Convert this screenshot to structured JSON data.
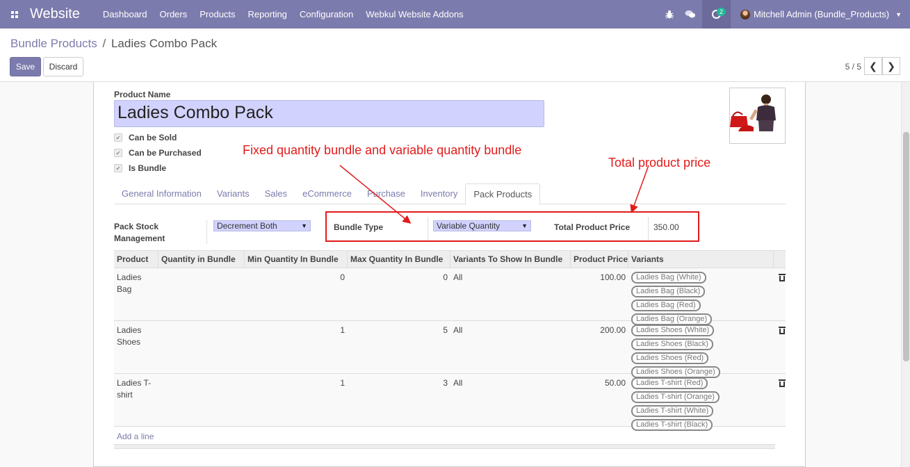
{
  "navbar": {
    "brand": "Website",
    "menu": [
      "Dashboard",
      "Orders",
      "Products",
      "Reporting",
      "Configuration",
      "Webkul Website Addons"
    ],
    "activity_count": "2",
    "user": "Mitchell Admin (Bundle_Products)",
    "icons": [
      "apps-icon",
      "bug-icon",
      "chat-icon",
      "activity-clock-icon",
      "caret-down-icon"
    ]
  },
  "breadcrumb": {
    "parent": "Bundle Products",
    "separator": "/",
    "current": "Ladies Combo Pack"
  },
  "buttons": {
    "save": "Save",
    "discard": "Discard"
  },
  "pager": {
    "value": "5 / 5",
    "prev": "❮",
    "next": "❯"
  },
  "form": {
    "product_name_label": "Product Name",
    "product_name": "Ladies Combo Pack",
    "checkboxes": [
      {
        "label": "Can be Sold",
        "checked": true
      },
      {
        "label": "Can be Purchased",
        "checked": true
      },
      {
        "label": "Is Bundle",
        "checked": true
      }
    ],
    "tabs": [
      "General Information",
      "Variants",
      "Sales",
      "eCommerce",
      "Purchase",
      "Inventory",
      "Pack Products"
    ],
    "active_tab": "Pack Products",
    "pack_stock_label": "Pack Stock Management",
    "pack_stock_value": "Decrement Both",
    "bundle_type_label": "Bundle Type",
    "bundle_type_value": "Variable Quantity",
    "total_price_label": "Total Product Price",
    "total_price_value": "350.00"
  },
  "annotations": {
    "bundle_note": "Fixed quantity bundle and variable quantity bundle",
    "price_note": "Total product price",
    "color": "#e21b1b"
  },
  "table": {
    "columns": [
      "Product",
      "Quantity in Bundle",
      "Min Quantity In Bundle",
      "Max Quantity In Bundle",
      "Variants To Show In Bundle",
      "Product Price",
      "Variants"
    ],
    "rows": [
      {
        "product": "Ladies Bag",
        "qty": "",
        "min": "0",
        "max": "0",
        "show": "All",
        "price": "100.00",
        "variants": [
          "Ladies Bag (White)",
          "Ladies Bag (Black)",
          "Ladies Bag (Red)",
          "Ladies Bag (Orange)"
        ]
      },
      {
        "product": "Ladies Shoes",
        "qty": "",
        "min": "1",
        "max": "5",
        "show": "All",
        "price": "200.00",
        "variants": [
          "Ladies Shoes (White)",
          "Ladies Shoes (Black)",
          "Ladies Shoes (Red)",
          "Ladies Shoes (Orange)"
        ]
      },
      {
        "product": "Ladies T-shirt",
        "qty": "",
        "min": "1",
        "max": "3",
        "show": "All",
        "price": "50.00",
        "variants": [
          "Ladies T-shirt (Red)",
          "Ladies T-shirt (Orange)",
          "Ladies T-shirt (White)",
          "Ladies T-shirt (Black)"
        ]
      }
    ],
    "add_line": "Add a line"
  },
  "colors": {
    "navbar": "#7c7bad",
    "primary": "#7c7bad",
    "input_bg": "#d2d2ff",
    "annotation": "#e21b1b"
  }
}
